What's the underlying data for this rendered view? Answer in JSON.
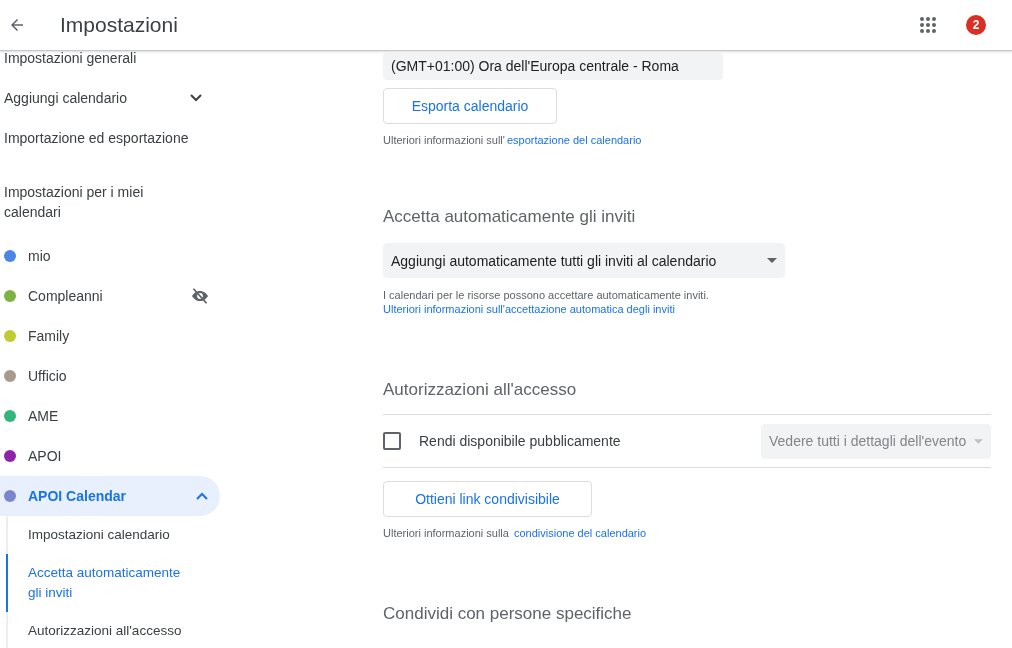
{
  "header": {
    "title": "Impostazioni",
    "notification_count": "2"
  },
  "sidebar": {
    "items": [
      {
        "label": "Impostazioni generali",
        "expandable": false
      },
      {
        "label": "Aggiungi calendario",
        "expandable": true
      },
      {
        "label": "Importazione ed esportazione",
        "expandable": false
      }
    ],
    "section_heading": "Impostazioni per i miei calendari",
    "calendars": [
      {
        "name": "mio",
        "color": "#4a86e8",
        "hidden": false,
        "selected": false
      },
      {
        "name": "Compleanni",
        "color": "#7cb342",
        "hidden": true,
        "selected": false
      },
      {
        "name": "Family",
        "color": "#c0ca33",
        "hidden": false,
        "selected": false
      },
      {
        "name": "Ufficio",
        "color": "#a79b8e",
        "hidden": false,
        "selected": false
      },
      {
        "name": "AME",
        "color": "#33b679",
        "hidden": false,
        "selected": false
      },
      {
        "name": "APOI",
        "color": "#8e24aa",
        "hidden": false,
        "selected": false
      },
      {
        "name": "APOI Calendar",
        "color": "#7986cb",
        "hidden": false,
        "selected": true,
        "expanded": true,
        "children": [
          {
            "label": "Impostazioni calendario",
            "selected": false
          },
          {
            "label": "Accetta automaticamente gli inviti",
            "selected": true
          },
          {
            "label": "Autorizzazioni all'accesso",
            "selected": false
          }
        ]
      }
    ]
  },
  "content": {
    "timezone_field": {
      "value": "(GMT+01:00) Ora dell'Europa centrale - Roma"
    },
    "export_button": "Esporta calendario",
    "export_note": {
      "text": "Ulteriori informazioni sull'",
      "link": "esportazione del calendario"
    },
    "sections": [
      {
        "kind": "auto_accept",
        "title": "Accetta automaticamente gli inviti",
        "dropdown": "Aggiungi automaticamente tutti gli inviti al calendario",
        "note": {
          "text": "I calendari per le risorse possono accettare automaticamente inviti. ",
          "link": "Ulteriori informazioni sull'accettazione automatica degli inviti"
        }
      },
      {
        "kind": "access",
        "title": "Autorizzazioni all'accesso",
        "public_checkbox": {
          "label": "Rendi disponibile pubblicamente",
          "checked": false
        },
        "detail_dropdown": {
          "value": "Vedere tutti i dettagli dell'evento",
          "disabled": true
        },
        "button": "Ottieni link condivisibile",
        "note": {
          "text": "Ulteriori informazioni sulla ",
          "link": "condivisione del calendario"
        }
      },
      {
        "kind": "share",
        "title": "Condividi con persone specifiche"
      }
    ]
  }
}
